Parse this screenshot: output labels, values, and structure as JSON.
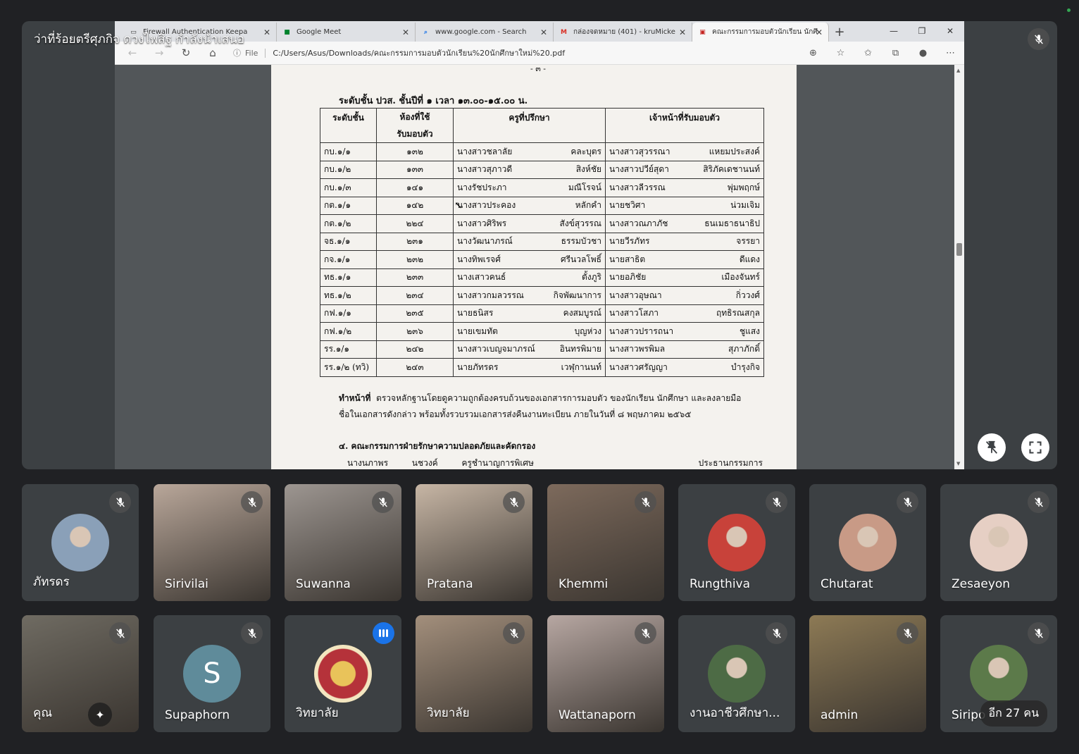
{
  "presenter_caption": "ว่าที่ร้อยตรีศุภกิจ ดวงไพสิฐ กำลังนำเสนอ",
  "browser": {
    "tabs": [
      {
        "title": "Firewall Authentication Keepa",
        "icon": "page-icon"
      },
      {
        "title": "Google Meet",
        "icon": "meet-icon"
      },
      {
        "title": "www.google.com - Search",
        "icon": "search-icon"
      },
      {
        "title": "กล่องจดหมาย (401) - kruMicke",
        "icon": "gmail-icon"
      },
      {
        "title": "คณะกรรมการมอบตัวนักเรียน นักศึ",
        "icon": "pdf-icon"
      }
    ],
    "new_tab": "+",
    "file_label": "File",
    "url": "C:/Users/Asus/Downloads/คณะกรรมการมอบตัวนักเรียน%20นักศึกษาใหม่%20.pdf"
  },
  "document": {
    "page_number": "- ๓ -",
    "heading": "ระดับชั้น ปวส. ชั้นปีที่ ๑ เวลา ๑๓.๐๐-๑๕.๐๐ น.",
    "columns": [
      "ระดับชั้น",
      "ห้องที่ใช้รับมอบตัว",
      "ครูที่ปรึกษา",
      "เจ้าหน้าที่รับมอบตัว"
    ],
    "column_room_lines": [
      "ห้องที่ใช้",
      "รับมอบตัว"
    ],
    "rows": [
      {
        "level": "กบ.๑/๑",
        "room": "๑๓๒",
        "t_first": "นางสาวชลาลัย",
        "t_last": "คละบุตร",
        "s_first": "นางสาวสุวรรณา",
        "s_last": "แหยมประสงค์"
      },
      {
        "level": "กบ.๑/๒",
        "room": "๑๓๓",
        "t_first": "นางสาวสุภาวดี",
        "t_last": "สิงห์ชัย",
        "s_first": "นางสาวปวีย์สุดา",
        "s_last": "สิริภัคเดชานนท์"
      },
      {
        "level": "กบ.๑/๓",
        "room": "๑๔๑",
        "t_first": "นางรัชประภา",
        "t_last": "มณีโรจน์",
        "s_first": "นางสาวลีวรรณ",
        "s_last": "พุ่มพฤกษ์"
      },
      {
        "level": "กต.๑/๑",
        "room": "๑๔๒",
        "t_first": "นางสาวประคอง",
        "t_last": "หลักคำ",
        "s_first": "นายชวิศา",
        "s_last": "น่วมเจิม"
      },
      {
        "level": "กต.๑/๒",
        "room": "๒๒๔",
        "t_first": "นางสาวศิริพร",
        "t_last": "สังข์สุวรรณ",
        "s_first": "นางสาวณภาภัช",
        "s_last": "ธนเมธาธนาธิป"
      },
      {
        "level": "จธ.๑/๑",
        "room": "๒๓๑",
        "t_first": "นางวัฒนาภรณ์",
        "t_last": "ธรรมบัวชา",
        "s_first": "นายวีรภัทร",
        "s_last": "จรรยา"
      },
      {
        "level": "กจ.๑/๑",
        "room": "๒๓๒",
        "t_first": "นางทิพเรจศ์",
        "t_last": "ศรีนวลโพธิ์",
        "s_first": "นายสาธิต",
        "s_last": "ดีแดง"
      },
      {
        "level": "ทธ.๑/๑",
        "room": "๒๓๓",
        "t_first": "นางเสาวคนธ์",
        "t_last": "ตั้งภูริ",
        "s_first": "นายอภิชัย",
        "s_last": "เมืองจันทร์"
      },
      {
        "level": "ทธ.๑/๒",
        "room": "๒๓๔",
        "t_first": "นางสาวกมลวรรณ",
        "t_last": "กิจพัฒนาการ",
        "s_first": "นางสาวอุษณา",
        "s_last": "กิ่ววงศ์"
      },
      {
        "level": "กฟ.๑/๑",
        "room": "๒๓๕",
        "t_first": "นายธนิสร",
        "t_last": "คงสมบูรณ์",
        "s_first": "นางสาวโสภา",
        "s_last": "ฤทธิรณสกุล"
      },
      {
        "level": "กฟ.๑/๒",
        "room": "๒๓๖",
        "t_first": "นายเขมทัต",
        "t_last": "บุญห่วง",
        "s_first": "นางสาวปรารถนา",
        "s_last": "ชูแสง"
      },
      {
        "level": "รร.๑/๑",
        "room": "๒๔๒",
        "t_first": "นางสาวเบญจมาภรณ์",
        "t_last": "อินทรพิมาย",
        "s_first": "นางสาวพรพิมล",
        "s_last": "สุภาภักดิ์"
      },
      {
        "level": "รร.๑/๒ (ทวิ)",
        "room": "๒๔๓",
        "t_first": "นายภัทรดร",
        "t_last": "เวฬุกานนท์",
        "s_first": "นางสาวศรัญญา",
        "s_last": "บำรุงกิจ"
      }
    ],
    "duty_label": "ทำหน้าที่",
    "duty_text": "ตรวจหลักฐานโดยดูความถูกต้องครบถ้วนของเอกสารการมอบตัว ของนักเรียน นักศึกษา และลงลายมือ",
    "duty_text2": "ชื่อในเอกสารดังกล่าว พร้อมทั้งรวบรวมเอกสารส่งคืนงานทะเบียน ภายในวันที่ ๘ พฤษภาคม ๒๕๖๕",
    "section4": "๔. คณะกรรมการฝ่ายรักษาความปลอดภัยและคัดกรอง",
    "section4_row": [
      "นางนภาพร",
      "นชวงค์",
      "ครูชำนาญการพิเศษ",
      "ประธานกรรมการ"
    ]
  },
  "participants_row1": [
    {
      "name": "ภัทรดร",
      "type": "avatar",
      "bg": "#8aa0b8"
    },
    {
      "name": "Sirivilai",
      "type": "video",
      "bg": "#b9a79a"
    },
    {
      "name": "Suwanna",
      "type": "video",
      "bg": "#9d9691"
    },
    {
      "name": "Pratana",
      "type": "video",
      "bg": "#c7b6a5"
    },
    {
      "name": "Khemmi",
      "type": "video",
      "bg": "#7d6a5c"
    },
    {
      "name": "Rungthiva",
      "type": "avatar",
      "bg": "#c8423a"
    },
    {
      "name": "Chutarat",
      "type": "avatar",
      "bg": "#c89a86"
    },
    {
      "name": "Zesaeyon",
      "type": "avatar",
      "bg": "#e6cfc4"
    }
  ],
  "participants_row2": [
    {
      "name": "คุณ",
      "type": "video",
      "bg": "#6f6b62"
    },
    {
      "name": "Supaphorn",
      "type": "letter",
      "letter": "S",
      "bg": "#5f8b9a"
    },
    {
      "name": "วิทยาลัย",
      "type": "seal",
      "bg": "#b5323a"
    },
    {
      "name": "วิทยาลัย",
      "type": "video",
      "bg": "#a38f7c"
    },
    {
      "name": "Wattanaporn",
      "type": "video",
      "bg": "#b7a7a2"
    },
    {
      "name": "งานอาชีวศึกษา...",
      "type": "avatar",
      "bg": "#4d6b45"
    },
    {
      "name": "admin",
      "type": "video",
      "bg": "#8d7a55"
    },
    {
      "name": "Siripo",
      "type": "avatar",
      "bg": "#5c7a4a"
    }
  ],
  "more_label": "อีก 27 คน"
}
